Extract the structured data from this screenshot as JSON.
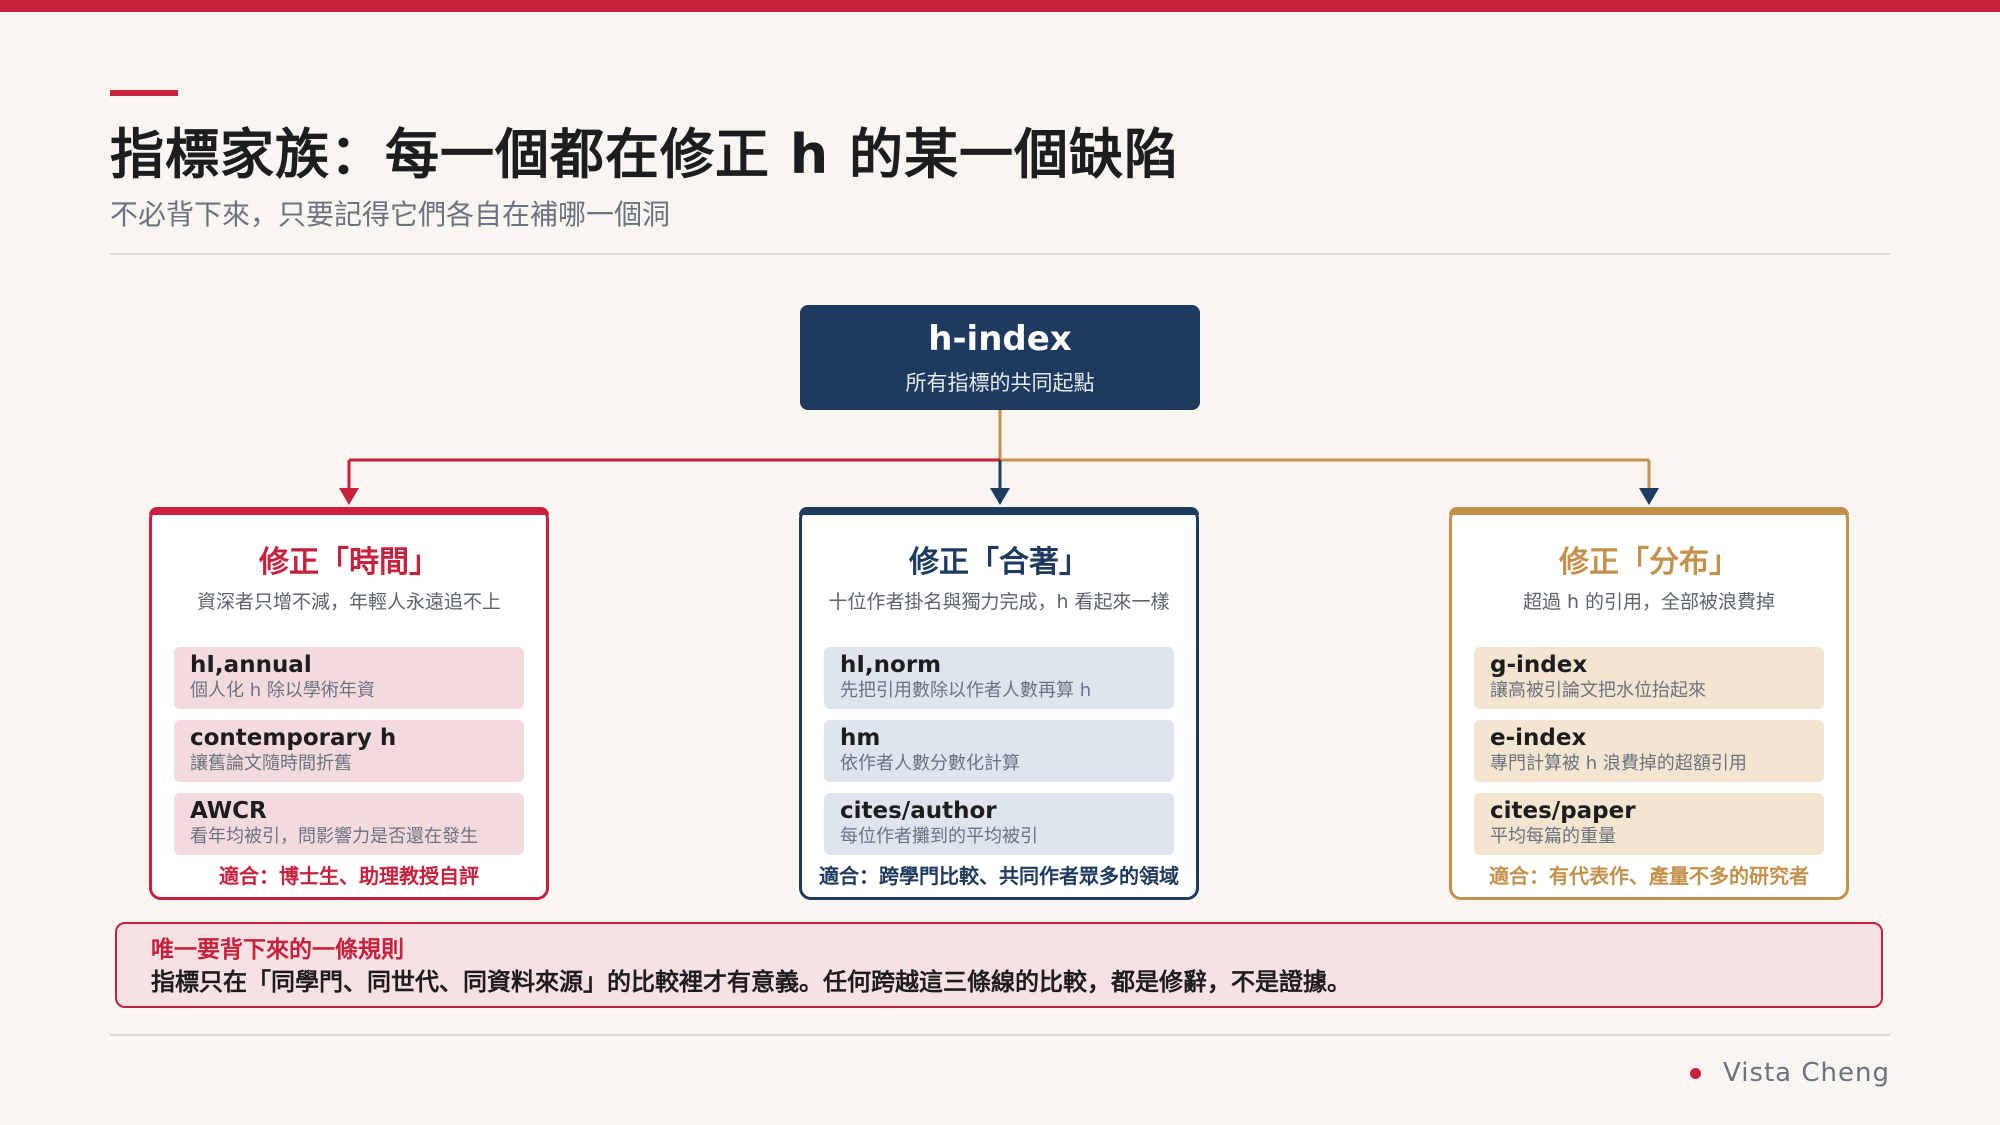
{
  "slide": {
    "title": "指標家族：每一個都在修正 h 的某一個缺陷",
    "subtitle": "不必背下來，只要記得它們各自在補哪一個洞"
  },
  "root": {
    "title": "h-index",
    "subtitle": "所有指標的共同起點"
  },
  "branches": [
    {
      "title": "修正「時間」",
      "desc": "資深者只增不減，年輕人永遠追不上",
      "color": "#c8213d",
      "items": [
        {
          "name": "hI,annual",
          "desc": "個人化 h 除以學術年資"
        },
        {
          "name": "contemporary h",
          "desc": "讓舊論文隨時間折舊"
        },
        {
          "name": "AWCR",
          "desc": "看年均被引，問影響力是否還在發生"
        }
      ],
      "fit": "適合：博士生、助理教授自評"
    },
    {
      "title": "修正「合著」",
      "desc": "十位作者掛名與獨力完成，h 看起來一樣",
      "color": "#1f3a5f",
      "items": [
        {
          "name": "hI,norm",
          "desc": "先把引用數除以作者人數再算 h"
        },
        {
          "name": "hm",
          "desc": "依作者人數分數化計算"
        },
        {
          "name": "cites/author",
          "desc": "每位作者攤到的平均被引"
        }
      ],
      "fit": "適合：跨學門比較、共同作者眾多的領域"
    },
    {
      "title": "修正「分布」",
      "desc": "超過 h 的引用，全部被浪費掉",
      "color": "#c4914a",
      "items": [
        {
          "name": "g-index",
          "desc": "讓高被引論文把水位抬起來"
        },
        {
          "name": "e-index",
          "desc": "專門計算被 h 浪費掉的超額引用"
        },
        {
          "name": "cites/paper",
          "desc": "平均每篇的重量"
        }
      ],
      "fit": "適合：有代表作、產量不多的研究者"
    }
  ],
  "rule": {
    "heading": "唯一要背下來的一條規則",
    "text": "指標只在「同學門、同世代、同資料來源」的比較裡才有意義。任何跨越這三條線的比較，都是修辭，不是證據。"
  },
  "footer": {
    "author": "Vista Cheng"
  }
}
